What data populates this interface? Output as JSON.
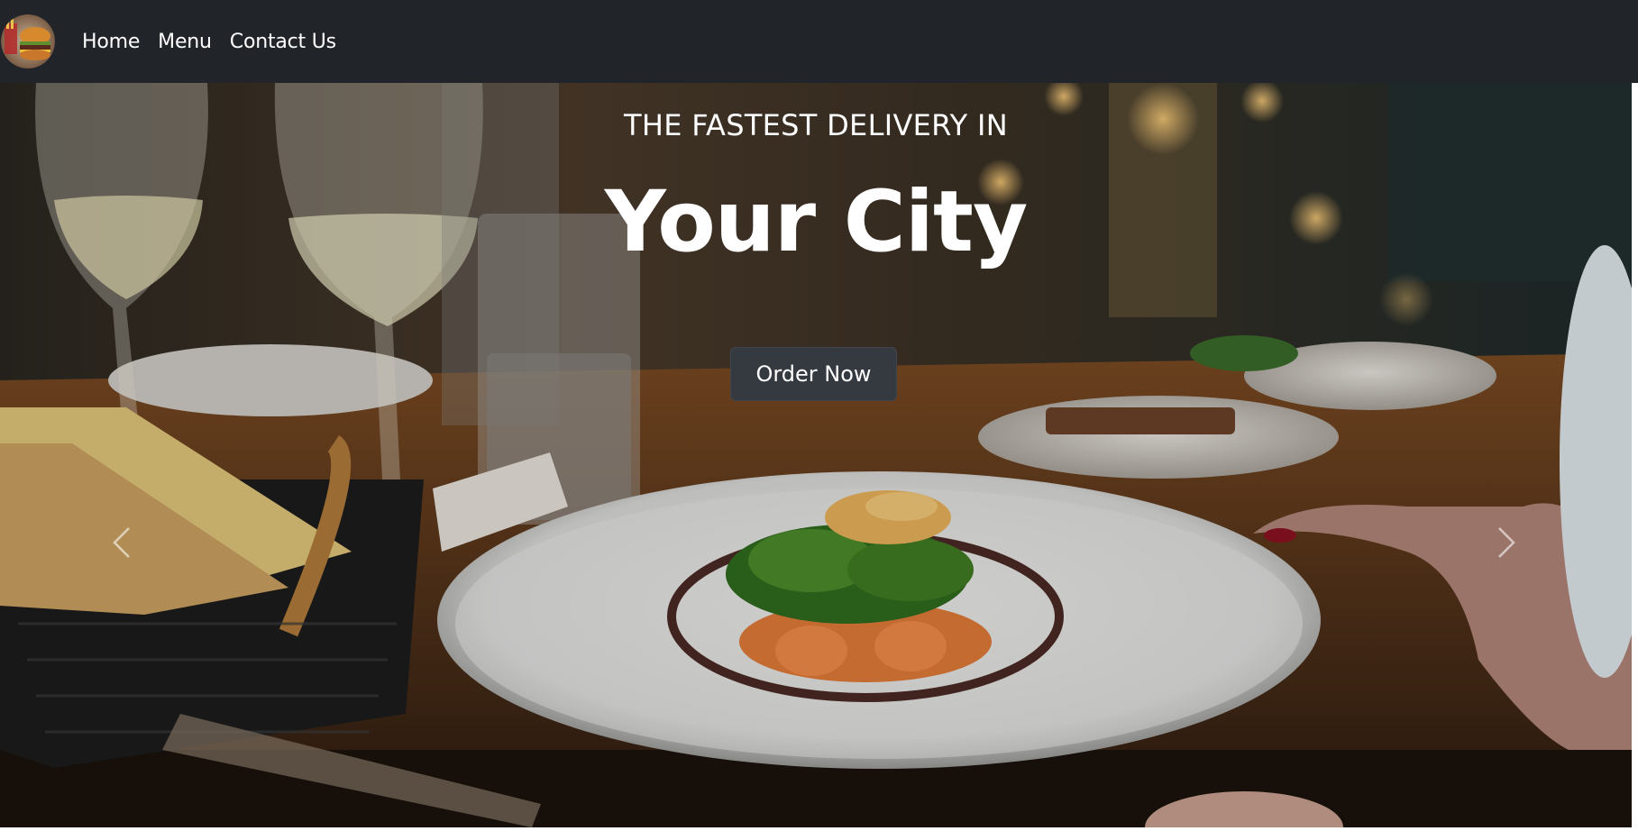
{
  "navbar": {
    "logo_icon": "burger-logo-icon",
    "links": [
      {
        "label": "Home"
      },
      {
        "label": "Menu"
      },
      {
        "label": "Contact Us"
      }
    ],
    "background_color": "#212529"
  },
  "hero": {
    "subtitle": "THE FASTEST DELIVERY IN",
    "headline": "Your City",
    "order_button_label": "Order Now",
    "prev_icon": "chevron-left-icon",
    "next_icon": "chevron-right-icon",
    "button_color": "#343a40"
  }
}
